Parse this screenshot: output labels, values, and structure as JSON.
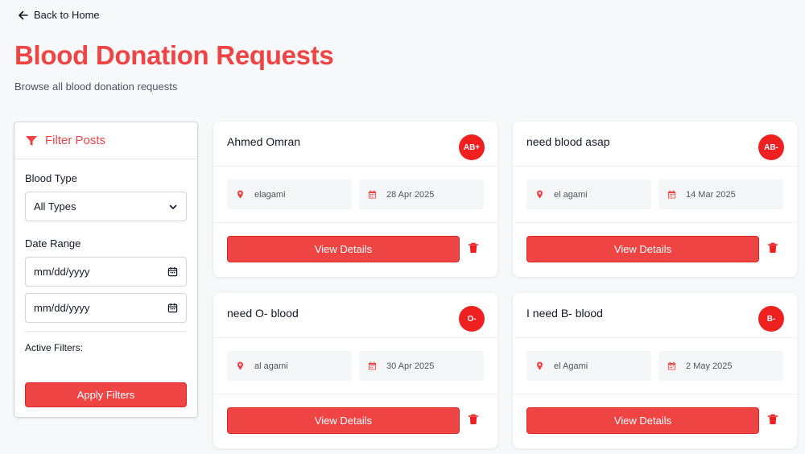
{
  "nav": {
    "back_label": "Back to Home"
  },
  "header": {
    "title": "Blood Donation Requests",
    "subtitle": "Browse all blood donation requests"
  },
  "filters": {
    "title": "Filter Posts",
    "blood_type_label": "Blood Type",
    "blood_type_value": "All Types",
    "date_range_label": "Date Range",
    "date_from_placeholder": "mm/dd/yyyy",
    "date_to_placeholder": "mm/dd/yyyy",
    "active_filters_label": "Active Filters:",
    "apply_label": "Apply Filters"
  },
  "posts": [
    {
      "title": "Ahmed Omran",
      "blood_type": "AB+",
      "location": "elagami",
      "date": "28 Apr 2025",
      "view_label": "View Details"
    },
    {
      "title": "need blood asap",
      "blood_type": "AB-",
      "location": "el agami",
      "date": "14 Mar 2025",
      "view_label": "View Details"
    },
    {
      "title": "need O- blood",
      "blood_type": "O-",
      "location": "al agami",
      "date": "30 Apr 2025",
      "view_label": "View Details"
    },
    {
      "title": "I need B- blood",
      "blood_type": "B-",
      "location": "el Agami",
      "date": "2 May 2025",
      "view_label": "View Details"
    }
  ],
  "icons": {
    "back": "arrow-left-icon",
    "filter": "funnel-icon",
    "chevron": "chevron-down-icon",
    "calendar": "calendar-icon",
    "location": "map-pin-icon",
    "trash": "trash-icon"
  },
  "colors": {
    "accent": "#ef4444",
    "badge": "#ef2020",
    "background": "#f7f8fa"
  }
}
